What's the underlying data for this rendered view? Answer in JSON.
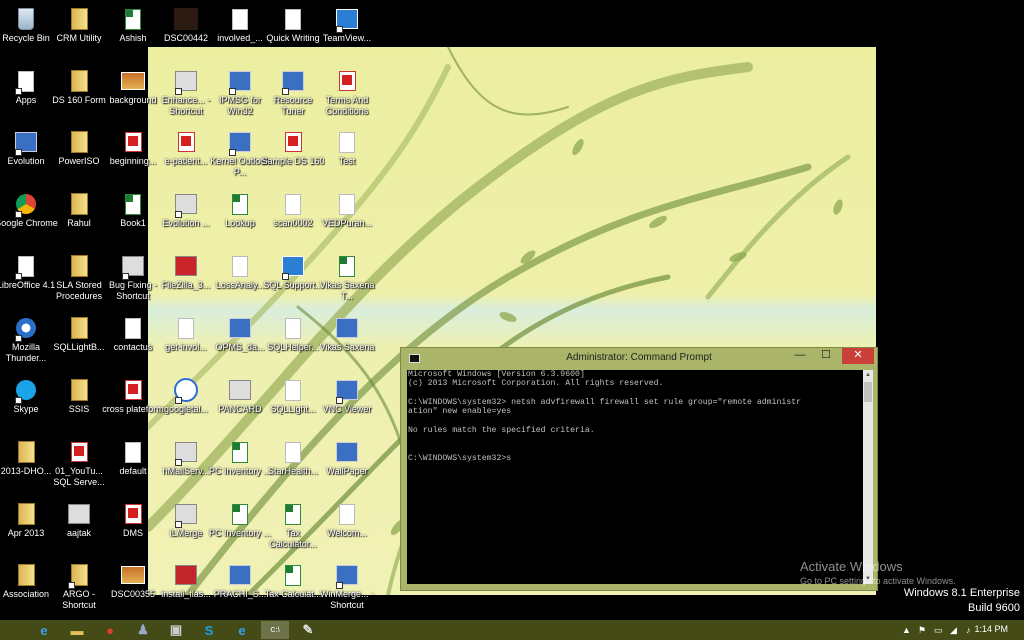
{
  "desktop": {
    "icons": [
      {
        "label": "Recycle Bin",
        "kind": "bin",
        "shortcut": false
      },
      {
        "label": "CRM Utility",
        "kind": "folder",
        "shortcut": false
      },
      {
        "label": "Ashish",
        "kind": "xls",
        "shortcut": false
      },
      {
        "label": "DSC00442",
        "kind": "dark",
        "shortcut": false
      },
      {
        "label": "involved_...",
        "kind": "doc",
        "shortcut": false
      },
      {
        "label": "Quick Writing",
        "kind": "doc",
        "shortcut": false
      },
      {
        "label": "TeamView...",
        "kind": "bluebox",
        "shortcut": true
      },
      {
        "label": "Apps",
        "kind": "doc",
        "shortcut": true
      },
      {
        "label": "DS 160 Form",
        "kind": "folder",
        "shortcut": false
      },
      {
        "label": "background",
        "kind": "img",
        "shortcut": false
      },
      {
        "label": "Enhance... - Shortcut",
        "kind": "exe",
        "shortcut": true
      },
      {
        "label": "IPMSG for Win32",
        "kind": "app",
        "shortcut": true
      },
      {
        "label": "Resource Tuner",
        "kind": "app",
        "shortcut": true
      },
      {
        "label": "Terms And Conditions",
        "kind": "pdf",
        "shortcut": false
      },
      {
        "label": "Evolution",
        "kind": "app",
        "shortcut": true
      },
      {
        "label": "PowerISO",
        "kind": "folder",
        "shortcut": false
      },
      {
        "label": "beginning...",
        "kind": "pdf",
        "shortcut": false
      },
      {
        "label": "e-patient...",
        "kind": "pdf",
        "shortcut": false
      },
      {
        "label": "Kernel Outlook P...",
        "kind": "app",
        "shortcut": true
      },
      {
        "label": "Sample DS 160",
        "kind": "pdf",
        "shortcut": false
      },
      {
        "label": "Test",
        "kind": "doc",
        "shortcut": false
      },
      {
        "label": "Google Chrome",
        "kind": "chrome",
        "shortcut": true
      },
      {
        "label": "Rahul",
        "kind": "folder",
        "shortcut": false
      },
      {
        "label": "Book1",
        "kind": "xls",
        "shortcut": false
      },
      {
        "label": "Evolution ...",
        "kind": "exe",
        "shortcut": true
      },
      {
        "label": "Lookup",
        "kind": "xls",
        "shortcut": false
      },
      {
        "label": "scan0002",
        "kind": "doc",
        "shortcut": false
      },
      {
        "label": "VEDPuran...",
        "kind": "doc",
        "shortcut": false
      },
      {
        "label": "LibreOffice 4.1",
        "kind": "doc",
        "shortcut": true
      },
      {
        "label": "SLA Stored Procedures",
        "kind": "folder",
        "shortcut": false
      },
      {
        "label": "Bug Fixing - Shortcut",
        "kind": "exe",
        "shortcut": true
      },
      {
        "label": "FileZilla_3...",
        "kind": "filezilla",
        "shortcut": false
      },
      {
        "label": "LossAnaly...",
        "kind": "doc",
        "shortcut": false
      },
      {
        "label": "SQL Support...",
        "kind": "bluebox",
        "shortcut": true
      },
      {
        "label": "Vikas Saxena T...",
        "kind": "xls",
        "shortcut": false
      },
      {
        "label": "Mozilla Thunder...",
        "kind": "thunderbird",
        "shortcut": true
      },
      {
        "label": "SQLLightB...",
        "kind": "folder",
        "shortcut": false
      },
      {
        "label": "contactus",
        "kind": "doc",
        "shortcut": false
      },
      {
        "label": "get-invol...",
        "kind": "doc",
        "shortcut": false
      },
      {
        "label": "OPMS_da...",
        "kind": "app",
        "shortcut": false
      },
      {
        "label": "SQLHelper...",
        "kind": "doc",
        "shortcut": false
      },
      {
        "label": "Vikas Saxena",
        "kind": "app",
        "shortcut": false
      },
      {
        "label": "Skype",
        "kind": "skype",
        "shortcut": true
      },
      {
        "label": "SSIS",
        "kind": "folder",
        "shortcut": false
      },
      {
        "label": "cross plateform",
        "kind": "pdf",
        "shortcut": false
      },
      {
        "label": "googletal...",
        "kind": "talk",
        "shortcut": true
      },
      {
        "label": "PANCARD",
        "kind": "exe",
        "shortcut": false
      },
      {
        "label": "SQLLight...",
        "kind": "doc",
        "shortcut": false
      },
      {
        "label": "VNC Viewer",
        "kind": "app",
        "shortcut": true
      },
      {
        "label": "2013-DHO...",
        "kind": "folder",
        "shortcut": false
      },
      {
        "label": "01_YouTu... SQL Serve...",
        "kind": "pdf",
        "shortcut": false
      },
      {
        "label": "default",
        "kind": "doc",
        "shortcut": false
      },
      {
        "label": "hMailServ...",
        "kind": "exe",
        "shortcut": true
      },
      {
        "label": "PC Inventory ...",
        "kind": "xls",
        "shortcut": false
      },
      {
        "label": "StarHealth...",
        "kind": "doc",
        "shortcut": false
      },
      {
        "label": "WallPaper",
        "kind": "app",
        "shortcut": false
      },
      {
        "label": "Apr 2013",
        "kind": "folder",
        "shortcut": false
      },
      {
        "label": "aajtak",
        "kind": "exe",
        "shortcut": false
      },
      {
        "label": "DMS",
        "kind": "pdf",
        "shortcut": false
      },
      {
        "label": "iLMerge",
        "kind": "exe",
        "shortcut": true
      },
      {
        "label": "PC Inventory ...",
        "kind": "xls",
        "shortcut": false
      },
      {
        "label": "Tax Calculator...",
        "kind": "xls",
        "shortcut": false
      },
      {
        "label": "Welcom...",
        "kind": "doc",
        "shortcut": false
      },
      {
        "label": "Association",
        "kind": "folder",
        "shortcut": false
      },
      {
        "label": "ARGO - Shortcut",
        "kind": "folder",
        "shortcut": true
      },
      {
        "label": "DSC00355",
        "kind": "img",
        "shortcut": false
      },
      {
        "label": "install_flas...",
        "kind": "flash",
        "shortcut": false
      },
      {
        "label": "PRACHI_S...",
        "kind": "app",
        "shortcut": false
      },
      {
        "label": "Tax Calculat...",
        "kind": "xls",
        "shortcut": false
      },
      {
        "label": "WinMerge... - Shortcut",
        "kind": "app",
        "shortcut": true
      }
    ]
  },
  "cmd_window": {
    "title": "Administrator: Command Prompt",
    "minimize": "—",
    "maximize": "☐",
    "close": "✕",
    "lines": [
      "Microsoft Windows [Version 6.3.9600]",
      "(c) 2013 Microsoft Corporation. All rights reserved.",
      "",
      "C:\\WINDOWS\\system32> netsh advfirewall firewall set rule group=\"remote administr",
      "ation\" new enable=yes",
      "",
      "No rules match the specified criteria.",
      "",
      "",
      "C:\\WINDOWS\\system32>s"
    ]
  },
  "watermark": {
    "title": "Activate Windows",
    "subtitle": "Go to PC settings to activate Windows."
  },
  "os_info": {
    "edition": "Windows 8.1 Enterprise",
    "build": "Build 9600"
  },
  "taskbar": {
    "items": [
      {
        "name": "internet-explorer-icon",
        "glyph": "e",
        "color": "#3aa0e8"
      },
      {
        "name": "file-explorer-icon",
        "glyph": "▬",
        "color": "#e5c05a"
      },
      {
        "name": "chrome-icon",
        "glyph": "●",
        "color": "#d9412b"
      },
      {
        "name": "people-icon",
        "glyph": "♟",
        "color": "#9ac"
      },
      {
        "name": "terminal-icon",
        "glyph": "▣",
        "color": "#ccc"
      },
      {
        "name": "skype-icon",
        "glyph": "S",
        "color": "#1aa3e8"
      },
      {
        "name": "internet-explorer-icon",
        "glyph": "e",
        "color": "#3aa0e8"
      },
      {
        "name": "command-prompt-icon",
        "glyph": "C:\\",
        "color": "#ddd"
      },
      {
        "name": "paint-icon",
        "glyph": "✎",
        "color": "#ddd"
      }
    ],
    "tray_symbols": [
      "▲",
      "⚑",
      "▭",
      "◢",
      "♪"
    ],
    "clock": "1:14 PM"
  },
  "colors": {
    "taskbar": "#444b17",
    "cmd_frame": "#aab569",
    "close_button": "#c9403a",
    "wallpaper_base": "#eef0a8"
  }
}
